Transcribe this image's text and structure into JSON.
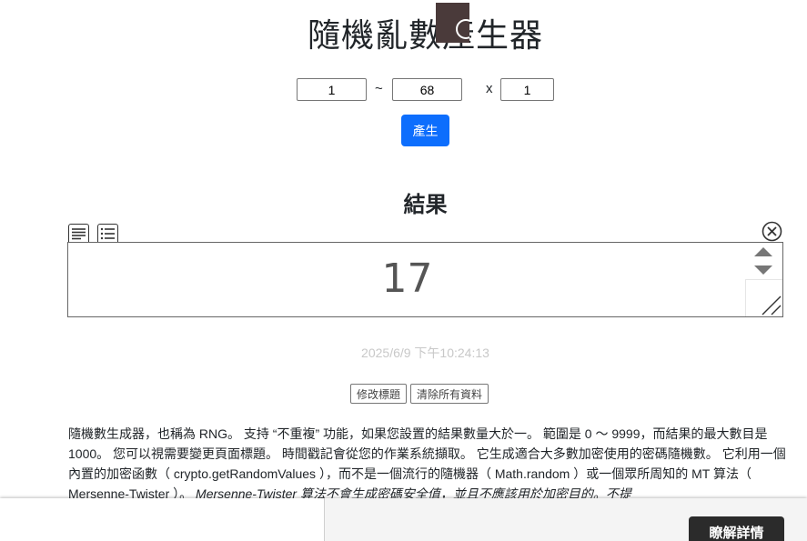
{
  "page": {
    "title": "隨機亂數產生器"
  },
  "range": {
    "min": "1",
    "separator": "~",
    "max": "68",
    "times_symbol": "x",
    "count": "1"
  },
  "generate_button": {
    "label": "產生"
  },
  "result": {
    "heading": "結果",
    "value": "17",
    "timestamp": "2025/6/9 下午10:24:13"
  },
  "actions": {
    "edit_title": "修改標題",
    "clear_all": "清除所有資料"
  },
  "description": {
    "p1": "隨機數生成器，也稱為 RNG。 支持 “不重複” 功能，如果您設置的結果數量大於一。 範圍是 0 ～ 9999，而結果的最大數目是 1000。 您可以視需要變更頁面標題。 時間戳記會從您的作業系統擷取。 它生成適合大多數加密使用的密碼隨機數。 它利用一個內置的加密函數（ crypto.getRandomValues ），而不是一個流行的隨機器（ Math.random ）或一個眾所周知的 MT 算法（ Mersenne-Twister ）。",
    "p1_em": "Mersenne-Twister 算法不會生成密碼安全值，並且不應該用於加密目的。不提"
  },
  "ad": {
    "cta_label": "瞭解詳情"
  },
  "colors": {
    "primary": "#0d6efd",
    "timestamp": "#c8c8c8",
    "cta_bg": "#2b2b2b"
  },
  "icons": [
    "paragraph-view-icon",
    "list-view-icon",
    "close-icon",
    "spinner-up-icon",
    "spinner-down-icon",
    "resize-handle-icon"
  ]
}
